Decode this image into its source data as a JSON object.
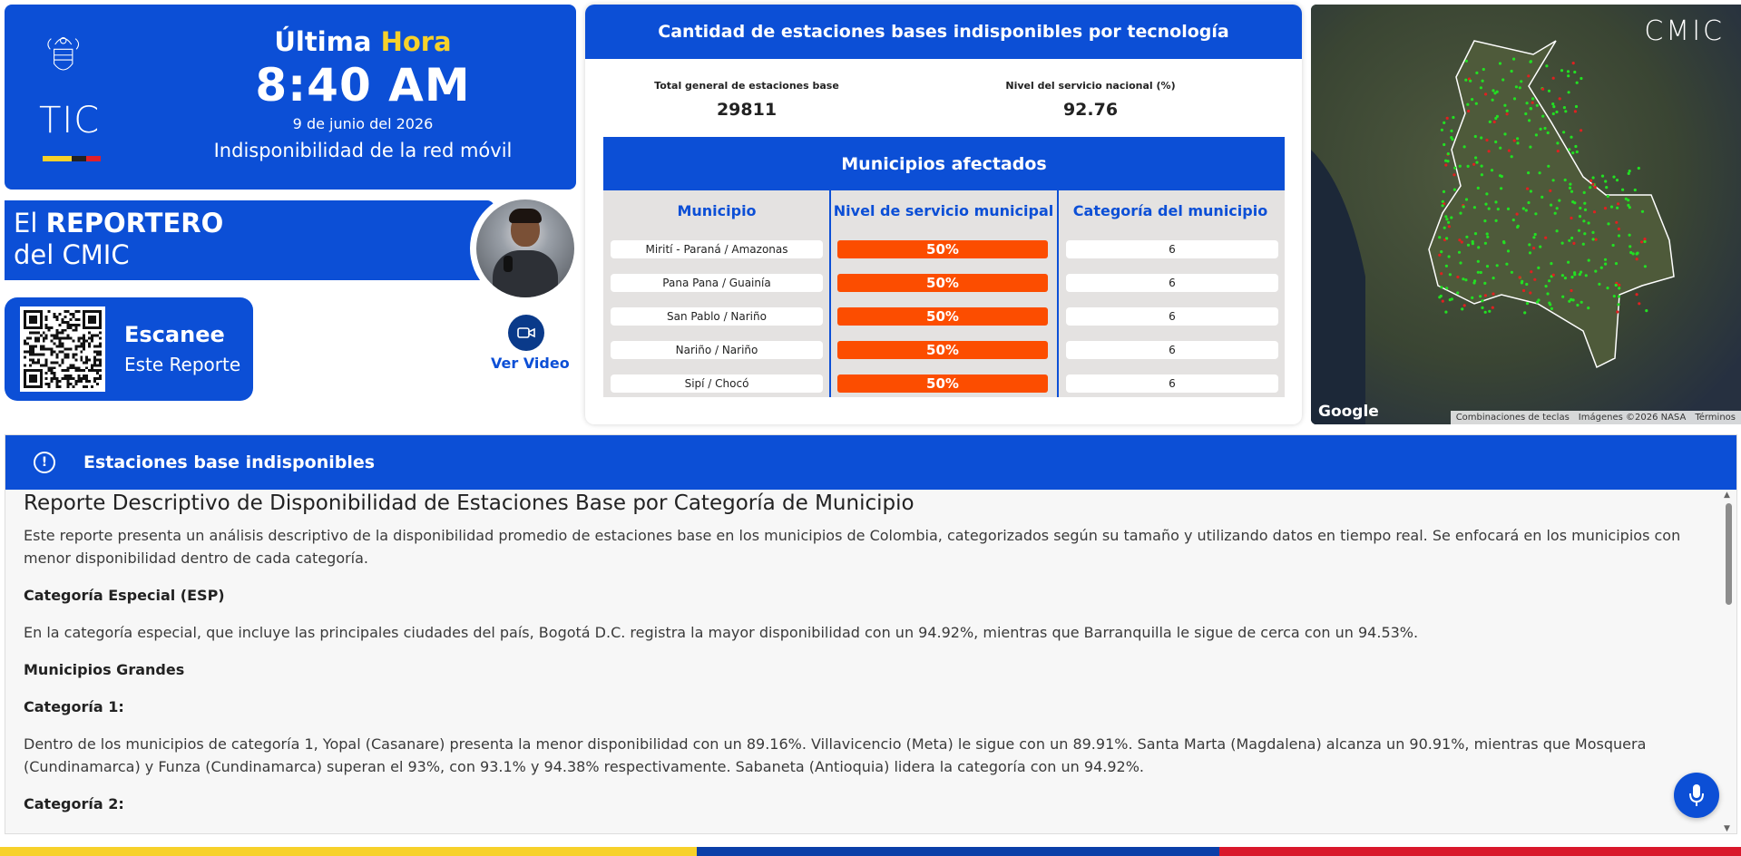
{
  "colors": {
    "brand_blue": "#0c4fd6",
    "accent_yellow": "#f7d12a",
    "alert_orange": "#fc4d00"
  },
  "header": {
    "logo_text": "TIC",
    "title_prefix": "Última",
    "title_accent": "Hora",
    "time": "8:40 AM",
    "date": "9 de junio del 2026",
    "subtitle": "Indisponibilidad de la red móvil"
  },
  "reporter": {
    "line1_prefix": "El",
    "line1_bold": "REPORTERO",
    "line2": "del CMIC",
    "video_label": "Ver Video",
    "video_icon": "video-camera-icon"
  },
  "qr_card": {
    "title": "Escanee",
    "subtitle": "Este Reporte",
    "icon": "qr-code-icon"
  },
  "stations_panel": {
    "title": "Cantidad de estaciones bases indisponibles por tecnología",
    "total_label": "Total general de estaciones base",
    "total_value": "29811",
    "service_label": "Nivel del servicio nacional (%)",
    "service_value": "92.76",
    "table": {
      "title": "Municipios afectados",
      "columns": [
        "Municipio",
        "Nivel de servicio municipal",
        "Categoría del municipio"
      ],
      "rows": [
        {
          "municipio": "Mirití - Paraná / Amazonas",
          "nivel": "50%",
          "categoria": "6"
        },
        {
          "municipio": "Pana Pana / Guainía",
          "nivel": "50%",
          "categoria": "6"
        },
        {
          "municipio": "San Pablo / Nariño",
          "nivel": "50%",
          "categoria": "6"
        },
        {
          "municipio": "Nariño / Nariño",
          "nivel": "50%",
          "categoria": "6"
        },
        {
          "municipio": "Sipí / Chocó",
          "nivel": "50%",
          "categoria": "6"
        }
      ]
    }
  },
  "map": {
    "brand": "CMIC",
    "provider": "Google",
    "attribution": [
      "Combinaciones de teclas",
      "Imágenes ©2026 NASA",
      "Términos"
    ]
  },
  "report": {
    "section_title": "Estaciones base indisponibles",
    "heading": "Reporte Descriptivo de Disponibilidad de Estaciones Base por Categoría de Municipio",
    "intro": "Este reporte presenta un análisis descriptivo de la disponibilidad promedio de estaciones base en los municipios de Colombia, categorizados según su tamaño y utilizando datos en tiempo real. Se enfocará en los municipios con menor disponibilidad dentro de cada categoría.",
    "esp_title": "Categoría Especial (ESP)",
    "esp_text": "En la categoría especial, que incluye las principales ciudades del país, Bogotá D.C. registra la mayor disponibilidad con un 94.92%, mientras que Barranquilla le sigue de cerca con un 94.53%.",
    "grandes_title": "Municipios Grandes",
    "cat1_title": "Categoría 1:",
    "cat1_text": "Dentro de los municipios de categoría 1, Yopal (Casanare) presenta la menor disponibilidad con un 89.16%. Villavicencio (Meta) le sigue con un 89.91%. Santa Marta (Magdalena) alcanza un 90.91%, mientras que Mosquera (Cundinamarca) y Funza (Cundinamarca) superan el 93%, con 93.1% y 94.38% respectivamente. Sabaneta (Antioquia) lidera la categoría con un 94.92%.",
    "cat2_title": "Categoría 2:"
  }
}
